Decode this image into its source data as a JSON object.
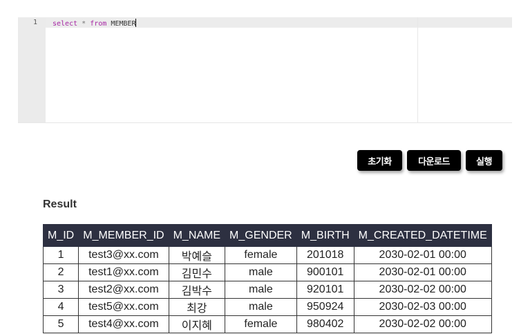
{
  "editor": {
    "line_number": "1",
    "query_keyword_select": "select",
    "query_star": "*",
    "query_keyword_from": "from",
    "query_table": "MEMBER"
  },
  "buttons": {
    "reset_label": "초기화",
    "download_label": "다운로드",
    "run_label": "실행"
  },
  "result": {
    "title": "Result",
    "columns": [
      "M_ID",
      "M_MEMBER_ID",
      "M_NAME",
      "M_GENDER",
      "M_BIRTH",
      "M_CREATED_DATETIME"
    ],
    "rows": [
      [
        "1",
        "test3@xx.com",
        "박예슬",
        "female",
        "201018",
        "2030-02-01 00:00"
      ],
      [
        "2",
        "test1@xx.com",
        "김민수",
        "male",
        "900101",
        "2030-02-01 00:00"
      ],
      [
        "3",
        "test2@xx.com",
        "김박수",
        "male",
        "920101",
        "2030-02-02 00:00"
      ],
      [
        "4",
        "test5@xx.com",
        "최강",
        "male",
        "950924",
        "2030-02-03 00:00"
      ],
      [
        "5",
        "test4@xx.com",
        "이지혜",
        "female",
        "980402",
        "2030-02-02 00:00"
      ]
    ]
  },
  "colors": {
    "header_bg": "#2d3041",
    "button_bg": "#000000",
    "keyword": "#a626a4"
  }
}
